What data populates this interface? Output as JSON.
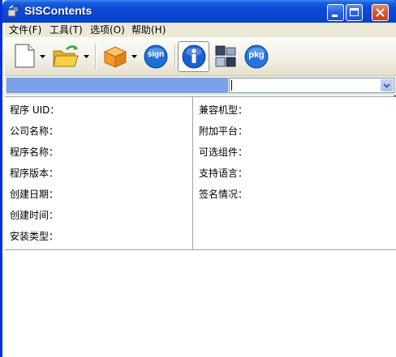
{
  "window": {
    "title": "SISContents",
    "controls": [
      "minimize",
      "maximize",
      "close"
    ]
  },
  "menu": [
    {
      "label": "文件(F)"
    },
    {
      "label": "工具(T)"
    },
    {
      "label": "选项(O)"
    },
    {
      "label": "帮助(H)"
    }
  ],
  "toolbar": {
    "buttons": [
      {
        "name": "new-file",
        "icon": "blank-document-icon",
        "has_dropdown": true
      },
      {
        "name": "open-folder",
        "icon": "open-folder-icon",
        "has_dropdown": true
      },
      {
        "name": "package",
        "icon": "package-box-icon",
        "has_dropdown": true
      },
      {
        "name": "sign",
        "icon": "sign-icon",
        "text": "sign"
      },
      {
        "name": "info",
        "icon": "info-icon",
        "active": true
      },
      {
        "name": "components",
        "icon": "components-icon"
      },
      {
        "name": "pkg",
        "icon": "pkg-icon",
        "text": "pkg"
      }
    ]
  },
  "selector": {
    "value": ""
  },
  "info": {
    "left": [
      {
        "label": "程序 UID："
      },
      {
        "label": "公司名称："
      },
      {
        "label": "程序名称："
      },
      {
        "label": "程序版本："
      },
      {
        "label": "创建日期："
      },
      {
        "label": "创建时间："
      },
      {
        "label": "安装类型："
      }
    ],
    "right": [
      {
        "label": "兼容机型："
      },
      {
        "label": "附加平台："
      },
      {
        "label": "可选组件："
      },
      {
        "label": "支持语言："
      },
      {
        "label": "签名情况："
      }
    ]
  },
  "colors": {
    "titlebar": "#0a49d8",
    "menubar": "#ece9d8",
    "selector_highlight": "#7ba2e7",
    "sign_badge": "#1f6fd6",
    "info_badge": "#1a5fd0",
    "pkg_badge": "#2573de",
    "package_orange": "#f39a2a",
    "folder_yellow": "#f7d046"
  }
}
